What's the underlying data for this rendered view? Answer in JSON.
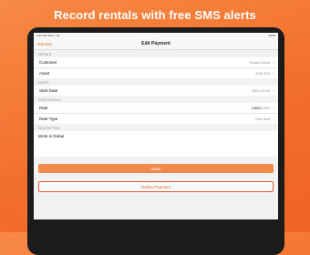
{
  "headline": "Record rentals with free SMS alerts",
  "status": {
    "left": "9:41 PM   Wed 1 Jul",
    "right": "100%"
  },
  "nav": {
    "back_label": "Rentals",
    "title": "Edit Payment"
  },
  "sections": {
    "details": "DETAILS",
    "dates": "DATES",
    "rate": "RATE DETAILS",
    "description": "DESCRIPTION"
  },
  "details_rows": [
    {
      "label": "Customer",
      "value": "Romel Davis"
    },
    {
      "label": "Asset",
      "value": "JOB 3CX"
    }
  ],
  "dates_rows": [
    {
      "label": "Start Date",
      "value": "2020-06-09"
    }
  ],
  "rate_rows": [
    {
      "label": "Rate",
      "value": "13000",
      "unit": "AED"
    },
    {
      "label": "Rate Type",
      "value": "One time"
    }
  ],
  "description_text": "Work in Dubai",
  "buttons": {
    "save": "Save",
    "delete": "Delete Payment"
  },
  "colors": {
    "accent": "#f26d2b",
    "danger": "#e4572e"
  }
}
